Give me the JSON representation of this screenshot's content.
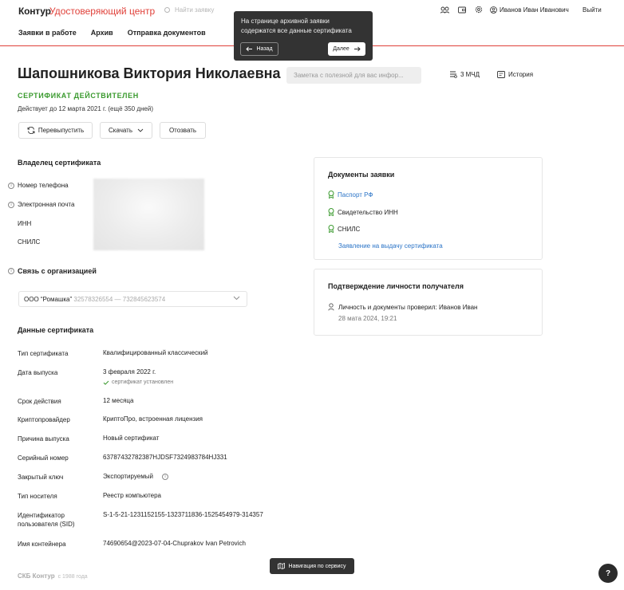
{
  "header": {
    "logo": "Контур",
    "logo_product": "Удостоверяющий центр",
    "search_placeholder": "Найти заявку",
    "nav": [
      "Заявки в работе",
      "Архив",
      "Отправка документов"
    ],
    "user_name": "Иванов Иван Иванович",
    "logout": "Выйти",
    "icons": [
      "users-icon",
      "wallet-icon",
      "gear-icon"
    ]
  },
  "tooltip": {
    "text": "На странице архивной заявки содержатся все данные сертификата",
    "back": "Назад",
    "next": "Далее"
  },
  "title": "Шапошникова Виктория Николаевна",
  "note_placeholder": "Заметка с полезной для вас инфор...",
  "mchd": "3 МЧД",
  "history": "История",
  "status": "СЕРТИФИКАТ ДЕЙСТВИТЕЛЕН",
  "valid_until": "Действует до 12 марта 2021 г. (ещё 350 дней)",
  "actions": {
    "reissue": "Перевыпустить",
    "download": "Скачать",
    "revoke": "Отозвать"
  },
  "owner": {
    "heading": "Владелец сертификата",
    "fields": [
      "Номер телефона",
      "Электронная почта",
      "ИНН",
      "СНИЛС"
    ]
  },
  "org": {
    "heading": "Связь с организацией",
    "name": "ООО “Ромашка”",
    "ids": "32578326554 — 732845623574"
  },
  "cert": {
    "heading": "Данные сертификата",
    "rows": [
      {
        "k": "Тип сертификата",
        "v": "Квалифицированный классический"
      },
      {
        "k": "Дата выпуска",
        "v": "3 февраля 2022 г."
      },
      {
        "k": "Срок действия",
        "v": "12 месяца"
      },
      {
        "k": "Криптопровайдер",
        "v": "КриптоПро, встроенная лицензия"
      },
      {
        "k": "Причина выпуска",
        "v": "Новый сертификат"
      },
      {
        "k": "Серийный номер",
        "v": "63787432782387HJDSF7324983784HJ331"
      },
      {
        "k": "Закрытый ключ",
        "v": "Экспортируемый"
      },
      {
        "k": "Тип носителя",
        "v": "Реестр компьютера"
      },
      {
        "k": "Идентификатор пользователя (SID)",
        "v": "S-1-5-21-1231152155-1323711836-1525454979-314357"
      },
      {
        "k": "Имя контейнера",
        "v": "74690654@2023-07-04-Chuprakov Ivan Petrovich"
      }
    ],
    "installed_note": "сертификат установлен"
  },
  "documents": {
    "heading": "Документы заявки",
    "items": [
      "Паспорт РФ",
      "Свидетельство ИНН",
      "СНИЛС"
    ],
    "application": "Заявление на выдачу сертификата"
  },
  "identity": {
    "heading": "Подтверждение личности получателя",
    "text": "Личность и документы проверил: Иванов Иван",
    "date": "28 мата 2024, 19:21"
  },
  "footer": {
    "company": "СКБ Контур",
    "since": "с 1988 года",
    "nav_button": "Навигация по сервису",
    "help": "?"
  },
  "colors": {
    "accent": "#e0413a",
    "success": "#3a9a2e",
    "link": "#2b74c7"
  }
}
